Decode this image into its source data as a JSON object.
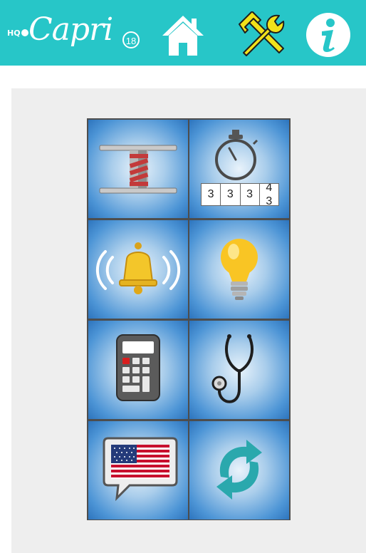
{
  "header": {
    "logo_prefix": "HQ",
    "logo_word": "Capri",
    "logo_number": "18",
    "buttons": [
      {
        "name": "home",
        "icon": "home-icon"
      },
      {
        "name": "tools",
        "icon": "tools-icon"
      },
      {
        "name": "info",
        "icon": "info-icon"
      }
    ],
    "colors": {
      "bar": "#27c6c8",
      "tools": "#f2e21a",
      "icon": "#ffffff"
    }
  },
  "grid": {
    "tiles": [
      {
        "name": "winch-drum",
        "icon": "winch-drum-icon"
      },
      {
        "name": "timer",
        "icon": "stopwatch-icon",
        "counter_digits": [
          "3",
          "3",
          "3",
          "4",
          "3"
        ]
      },
      {
        "name": "alarm",
        "icon": "ringing-bell-icon"
      },
      {
        "name": "tips",
        "icon": "lightbulb-icon"
      },
      {
        "name": "calculator",
        "icon": "calculator-icon"
      },
      {
        "name": "diagnostics",
        "icon": "stethoscope-icon"
      },
      {
        "name": "language",
        "icon": "us-flag-speech-bubble-icon"
      },
      {
        "name": "sync",
        "icon": "refresh-icon"
      }
    ],
    "colors": {
      "tile_edge": "#2d74bd",
      "tile_center": "#e9f3fb",
      "border": "#4d4d4d"
    }
  }
}
